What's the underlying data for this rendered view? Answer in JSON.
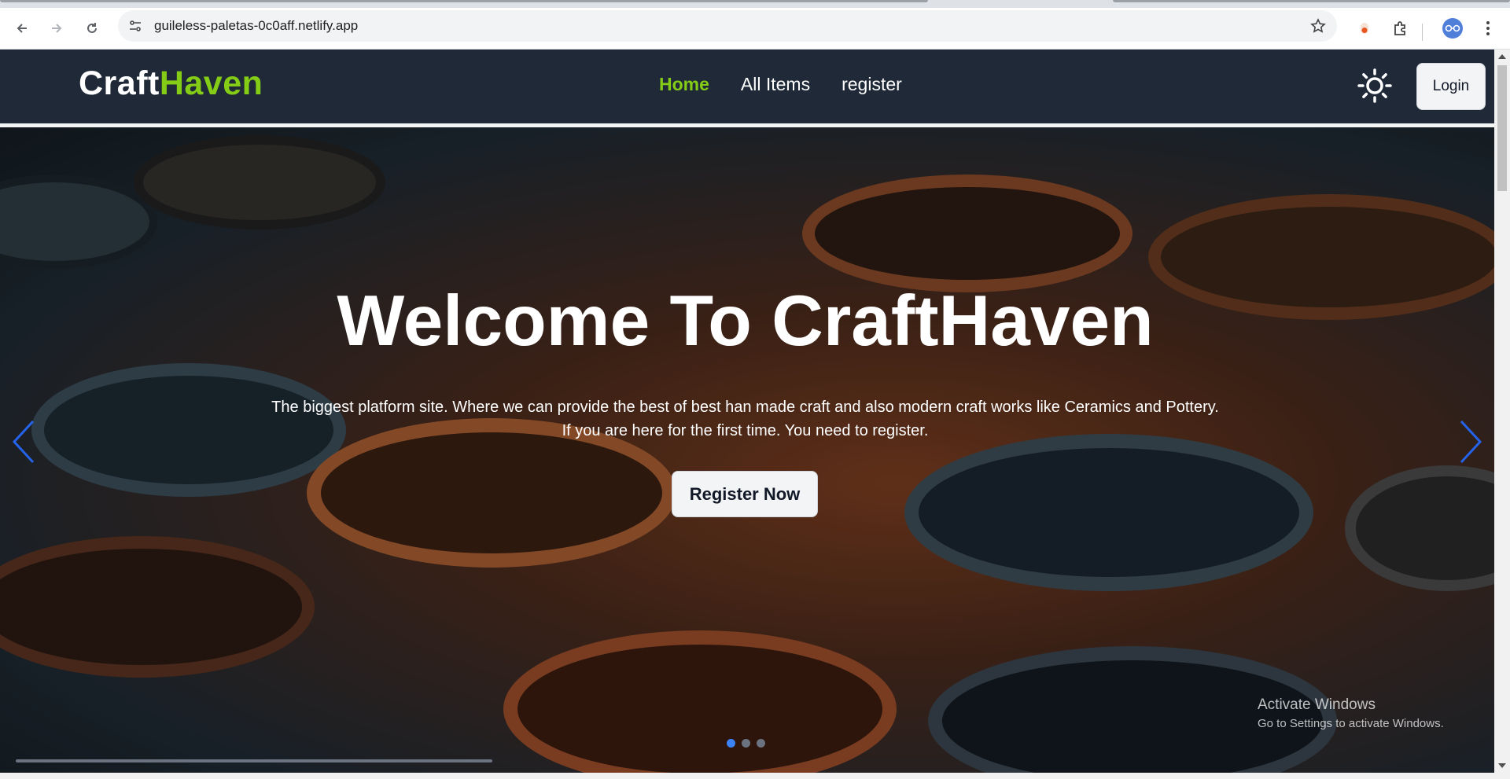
{
  "browser": {
    "url": "guileless-paletas-0c0aff.netlify.app",
    "back_icon": "arrow-left-icon",
    "forward_icon": "arrow-right-icon",
    "reload_icon": "reload-icon",
    "site_info_icon": "tune-icon",
    "bookmark_icon": "star-outline-icon",
    "extension_icon": "puzzle-icon",
    "menu_icon": "kebab-menu-icon"
  },
  "navbar": {
    "logo_part1": "Craft",
    "logo_part2": "Haven",
    "logo_color_primary": "#ffffff",
    "logo_color_accent": "#84cc16",
    "links": [
      {
        "label": "Home",
        "active": true
      },
      {
        "label": "All Items",
        "active": false
      },
      {
        "label": "register",
        "active": false
      }
    ],
    "theme_icon": "sun-icon",
    "login_label": "Login",
    "background": "#1f2937"
  },
  "hero": {
    "title": "Welcome To CraftHaven",
    "subtitle_line1": "The biggest platform site. Where we can provide the best of best han made craft and also modern craft works like Ceramics and Pottery.",
    "subtitle_line2": "If you are here for the first time. You need to register.",
    "cta_label": "Register Now",
    "prev_icon": "chevron-left-icon",
    "next_icon": "chevron-right-icon",
    "slides": 3,
    "active_slide": 1,
    "accent_color": "#3b82f6"
  },
  "os_watermark": {
    "line1": "Activate Windows",
    "line2": "Go to Settings to activate Windows."
  }
}
